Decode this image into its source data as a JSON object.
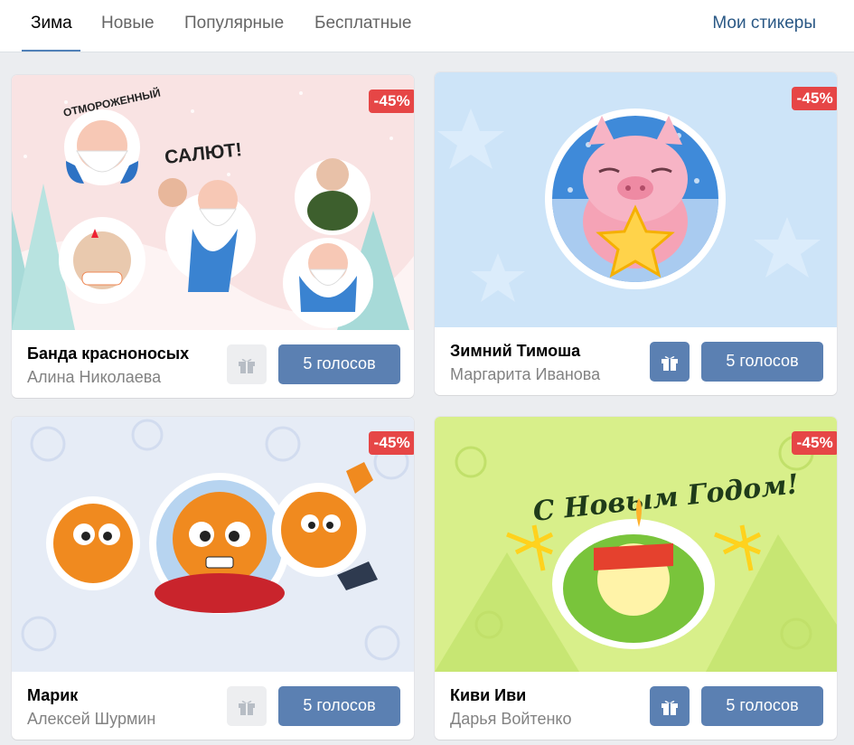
{
  "tabs": [
    {
      "label": "Зима",
      "active": true
    },
    {
      "label": "Новые"
    },
    {
      "label": "Популярные"
    },
    {
      "label": "Бесплатные"
    }
  ],
  "my_stickers_link": "Мои стикеры",
  "accent_color": "#5181b8",
  "discount_color": "#e64646",
  "packs": [
    {
      "title": "Банда красноносых",
      "author": "Алина Николаева",
      "discount": "-45%",
      "vote_label": "5 голосов",
      "gift_enabled": false,
      "cover_text": [
        "ОТМОРОЖЕННЫЙ",
        "САЛЮТ!"
      ]
    },
    {
      "title": "Зимний Тимоша",
      "author": "Маргарита Иванова",
      "discount": "-45%",
      "vote_label": "5 голосов",
      "gift_enabled": true
    },
    {
      "title": "Марик",
      "author": "Алексей Шурмин",
      "discount": "-45%",
      "vote_label": "5 голосов",
      "gift_enabled": false
    },
    {
      "title": "Киви Иви",
      "author": "Дарья Войтенко",
      "discount": "-45%",
      "vote_label": "5 голосов",
      "gift_enabled": true,
      "cover_text": [
        "С Новым Годом!"
      ]
    }
  ]
}
